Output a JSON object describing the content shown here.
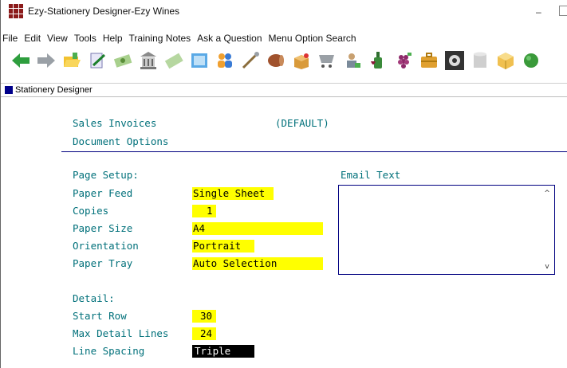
{
  "window": {
    "title": "Ezy-Stationery Designer-Ezy Wines",
    "minimize_glyph": "–"
  },
  "menu": [
    "File",
    "Edit",
    "View",
    "Tools",
    "Help",
    "Training Notes",
    "Ask a Question",
    "Menu Option Search"
  ],
  "toolbar": {
    "icons": [
      "back-arrow-icon",
      "forward-arrow-icon",
      "folder-open-icon",
      "edit-document-icon",
      "money-icon",
      "building-icon",
      "cash-icon",
      "document-icon",
      "people-icon",
      "tools-icon",
      "barrel-icon",
      "package-icon",
      "cart-icon",
      "worker-icon",
      "wine-bottle-icon",
      "grapes-icon",
      "briefcase-icon",
      "settings-gear-icon",
      "cylinder-icon",
      "box-icon",
      "leaf-icon"
    ]
  },
  "tab": {
    "label": "Stationery Designer"
  },
  "header": {
    "document_type": "Sales Invoices",
    "default_tag": "(DEFAULT)",
    "subtitle": "Document Options"
  },
  "page_setup": {
    "section_label": "Page Setup:",
    "paper_feed_label": "Paper Feed",
    "paper_feed_value": "Single Sheet",
    "copies_label": "Copies",
    "copies_value": "1",
    "paper_size_label": "Paper Size",
    "paper_size_value": "A4",
    "orientation_label": "Orientation",
    "orientation_value": "Portrait",
    "paper_tray_label": "Paper Tray",
    "paper_tray_value": "Auto Selection"
  },
  "email": {
    "label": "Email Text",
    "value": ""
  },
  "detail": {
    "section_label": "Detail:",
    "start_row_label": "Start Row",
    "start_row_value": "30",
    "max_lines_label": "Max Detail Lines",
    "max_lines_value": "24",
    "line_spacing_label": "Line Spacing",
    "line_spacing_value": "Triple"
  },
  "colors": {
    "label_teal": "#00707a",
    "field_highlight": "#ffff00",
    "rule_navy": "#000080"
  }
}
